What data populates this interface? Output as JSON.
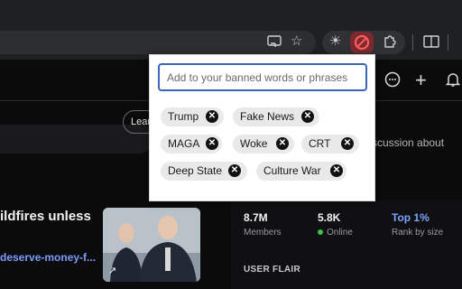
{
  "browser": {
    "icons": [
      "cast-icon",
      "bookmark-star-icon",
      "extension-sun-icon",
      "extension-ban-icon",
      "puzzle-extensions-icon",
      "reading-list-icon"
    ]
  },
  "popup": {
    "input": {
      "placeholder": "Add to your banned words or phrases",
      "value": ""
    },
    "banned_words": [
      "Trump",
      "Fake News",
      "MAGA",
      "Woke",
      "CRT",
      "Deep State",
      "Culture War"
    ]
  },
  "page": {
    "learn_button": "Lear",
    "discussion_text": "scussion about",
    "post_title": "ildfires unless",
    "post_link": "deserve-money-f...",
    "stats": [
      {
        "value": "8.7M",
        "label": "Members"
      },
      {
        "value": "5.8K",
        "label": "Online"
      },
      {
        "value": "Top 1%",
        "label": "Rank by size"
      }
    ],
    "user_flair": "USER FLAIR"
  },
  "colors": {
    "accent": "#3b66b8",
    "link": "#7c9cff",
    "online": "#42c04c",
    "extension_active": "#7a2a2e"
  }
}
